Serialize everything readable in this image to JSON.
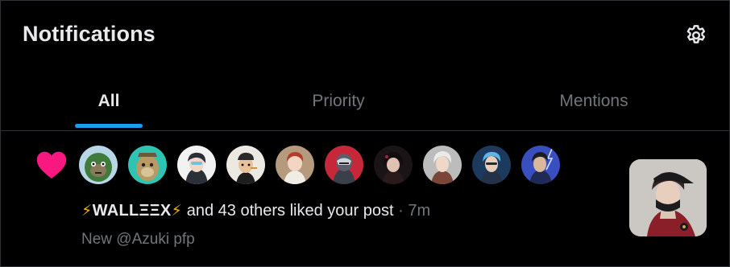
{
  "header": {
    "title": "Notifications",
    "settings_icon": "gear-icon"
  },
  "tabs": [
    {
      "label": "All",
      "active": true
    },
    {
      "label": "Priority",
      "active": false
    },
    {
      "label": "Mentions",
      "active": false
    }
  ],
  "colors": {
    "accent": "#1d9bf0",
    "heart": "#f91880",
    "muted": "#71767b",
    "text": "#e7e9ea",
    "background": "#000000"
  },
  "notification": {
    "icon": "heart-icon",
    "avatars": [
      {
        "name": "avatar-1"
      },
      {
        "name": "avatar-2"
      },
      {
        "name": "avatar-3"
      },
      {
        "name": "avatar-4"
      },
      {
        "name": "avatar-5"
      },
      {
        "name": "avatar-6"
      },
      {
        "name": "avatar-7"
      },
      {
        "name": "avatar-8"
      },
      {
        "name": "avatar-9"
      },
      {
        "name": "avatar-10"
      }
    ],
    "user_bolt_left": "⚡",
    "user_name": "WALLΞΞX",
    "user_bolt_right": "⚡",
    "action_text": " and 43 others liked your post",
    "separator": " · ",
    "time": "7m",
    "post_preview": "New @Azuki pfp"
  }
}
